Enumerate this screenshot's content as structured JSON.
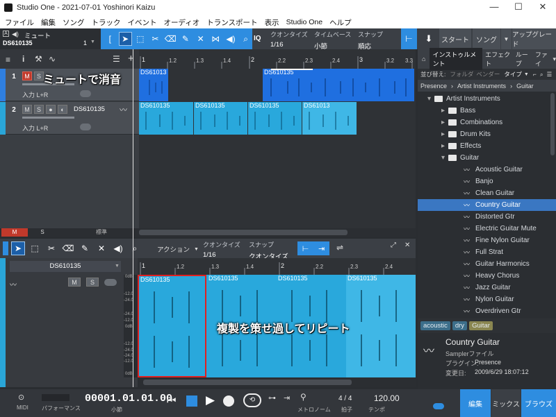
{
  "window": {
    "title": "Studio One - 2021-07-01 Yoshinori Kaizu",
    "minimize": "—",
    "maximize": "☐",
    "close": "✕"
  },
  "menu": [
    "ファイル",
    "編集",
    "ソング",
    "トラック",
    "イベント",
    "オーディオ",
    "トランスポート",
    "表示",
    "Studio One",
    "ヘルプ"
  ],
  "toolbar": {
    "mute_label": "ミュート",
    "track_name": "DS610135",
    "track_num": "1",
    "quantize_label": "クオンタイズ",
    "quantize_value": "1/16",
    "timebase_label": "タイムベース",
    "timebase_value": "小節",
    "snap_label": "スナップ",
    "snap_value": "順応",
    "iq": "IQ",
    "start": "スタート",
    "song": "ソング",
    "upgrade": "アップグレード"
  },
  "ruler_top": [
    "1",
    "1.2",
    "1.3",
    "1.4",
    "2",
    "2.2",
    "2.3",
    "2.4",
    "3",
    "3.2",
    "3.3"
  ],
  "tracks": [
    {
      "num": "1",
      "m": "M",
      "s": "S",
      "input": "入力 L+R",
      "muted": true
    },
    {
      "num": "2",
      "m": "M",
      "s": "S",
      "name": "DS610135",
      "input": "入力 L+R",
      "muted": false
    }
  ],
  "track1_events": [
    "DS61013",
    "DS610135"
  ],
  "track2_events": [
    "DS610135",
    "DS610135",
    "DS610135",
    "DS61013"
  ],
  "annotations": {
    "mute": "ミュートで消音",
    "repeat": "複製を策せ過してリピート"
  },
  "bottom_left": {
    "m": "M",
    "s": "S",
    "std": "標準"
  },
  "editor": {
    "action": "アクション",
    "quantize_label": "クオンタイズ",
    "quantize_value": "1/16",
    "snap_label": "スナップ",
    "snap_value": "クオンタイズ",
    "track_name": "DS610135",
    "m": "M",
    "s": "S",
    "ruler": [
      "1",
      "1.2",
      "1.3",
      "1.4",
      "2",
      "2.2",
      "2.3",
      "2.4"
    ],
    "events": [
      "DS610135",
      "DS610135",
      "DS610135",
      "DS610135"
    ],
    "db_labels": [
      "0dB",
      "-12.0",
      "-24.0",
      "-24.0",
      "-12.0",
      "0dB",
      "-12.0",
      "-24.0",
      "-24.0",
      "-12.0",
      "0dB"
    ]
  },
  "browser": {
    "tabs": [
      "インストゥルメント",
      "エフェクト",
      "ループ",
      "ファイ"
    ],
    "sort_label": "並び替え:",
    "sort_opts": [
      "フォルダ",
      "ベンダー",
      "タイプ"
    ],
    "path": [
      "Presence",
      "Artist Instruments",
      "Guitar"
    ],
    "items": [
      {
        "label": "Artist Instruments",
        "kind": "folder-open",
        "indent": 1
      },
      {
        "label": "Bass",
        "kind": "folder",
        "indent": 2
      },
      {
        "label": "Combinations",
        "kind": "folder",
        "indent": 2
      },
      {
        "label": "Drum Kits",
        "kind": "folder",
        "indent": 2
      },
      {
        "label": "Effects",
        "kind": "folder",
        "indent": 2
      },
      {
        "label": "Guitar",
        "kind": "folder-open",
        "indent": 2
      },
      {
        "label": "Acoustic Guitar",
        "kind": "preset",
        "indent": 3
      },
      {
        "label": "Banjo",
        "kind": "preset",
        "indent": 3
      },
      {
        "label": "Clean Guitar",
        "kind": "preset",
        "indent": 3
      },
      {
        "label": "Country Guitar",
        "kind": "preset",
        "indent": 3,
        "selected": true
      },
      {
        "label": "Distorted Gtr",
        "kind": "preset",
        "indent": 3
      },
      {
        "label": "Electric Guitar Mute",
        "kind": "preset",
        "indent": 3
      },
      {
        "label": "Fine Nylon Guitar",
        "kind": "preset",
        "indent": 3
      },
      {
        "label": "Full Strat",
        "kind": "preset",
        "indent": 3
      },
      {
        "label": "Guitar Harmonics",
        "kind": "preset",
        "indent": 3
      },
      {
        "label": "Heavy Chorus",
        "kind": "preset",
        "indent": 3
      },
      {
        "label": "Jazz Guitar",
        "kind": "preset",
        "indent": 3
      },
      {
        "label": "Nylon Guitar",
        "kind": "preset",
        "indent": 3
      },
      {
        "label": "Overdriven Gtr",
        "kind": "preset",
        "indent": 3
      }
    ],
    "tags": [
      "acoustic",
      "dry",
      "Guitar"
    ],
    "info": {
      "title": "Country Guitar",
      "type": "Samplerファイル",
      "plugin_label": "プラグイン:",
      "plugin": "Presence",
      "modified_label": "変更日:",
      "modified": "2009/6/29 18:07:12"
    }
  },
  "transport": {
    "midi": "MIDI",
    "performance": "パフォーマンス",
    "time": "00001.01.01.00",
    "time_unit": "小節",
    "metronome": "メトロノーム",
    "sig": "4 / 4",
    "sig_label": "拍子",
    "tempo": "120.00",
    "tempo_label": "テンポ",
    "edit": "編集",
    "mix": "ミックス",
    "browse": "ブラウズ"
  },
  "colors": {
    "accent": "#2e8de0",
    "event_blue": "#1f6fe0",
    "event_cyan": "#29a8dc",
    "mute_red": "#c0392b"
  }
}
